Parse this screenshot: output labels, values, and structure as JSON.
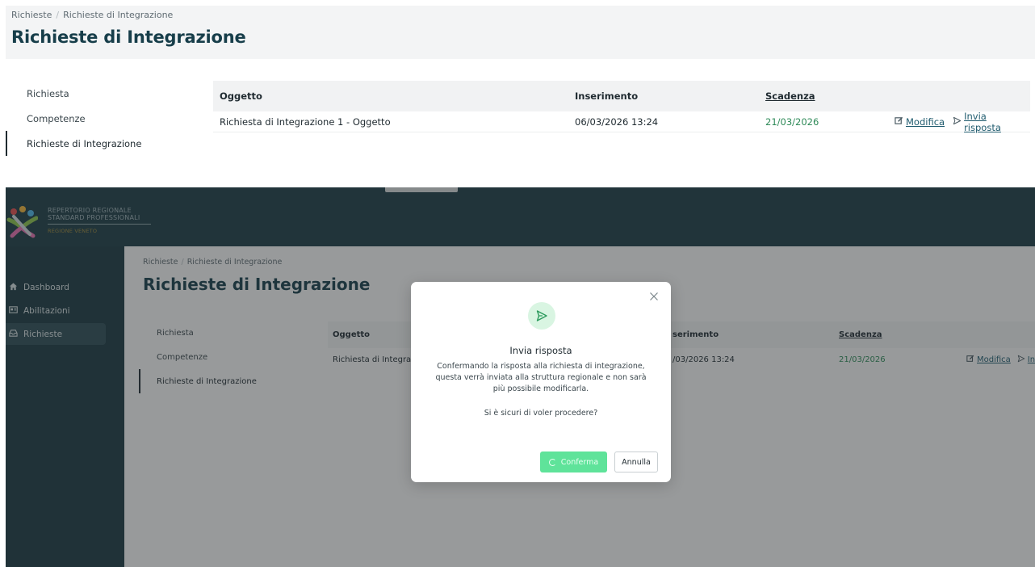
{
  "top": {
    "breadcrumb": [
      "Richieste",
      "Richieste di Integrazione"
    ],
    "breadcrumb_separator": "/",
    "title": "Richieste di Integrazione",
    "nav": [
      "Richiesta",
      "Competenze",
      "Richieste di Integrazione"
    ],
    "active_nav": "Richieste di Integrazione",
    "table": {
      "headers": [
        "Oggetto",
        "Inserimento",
        "Scadenza"
      ],
      "rows": [
        {
          "oggetto": "Richiesta di Integrazione 1 - Oggetto",
          "inserimento": "06/03/2026 13:24",
          "scadenza": "21/03/2026",
          "actions": [
            "Modifica",
            "Invia risposta"
          ]
        }
      ]
    }
  },
  "app": {
    "banner_button_color": "#d6dadb",
    "logo": {
      "line1": "REPERTORIO REGIONALE",
      "line2": "STANDARD PROFESSIONALI",
      "line3": "REGIONE VENETO"
    },
    "sidebar": [
      {
        "label": "Dashboard",
        "icon": "home-icon"
      },
      {
        "label": "Abilitazioni",
        "icon": "id-card-icon"
      },
      {
        "label": "Richieste",
        "icon": "inbox-icon",
        "active": true
      }
    ],
    "breadcrumb": [
      "Richieste",
      "Richieste di Integrazione"
    ],
    "breadcrumb_separator": "/",
    "title": "Richieste di Integrazione",
    "nav": [
      "Richiesta",
      "Competenze",
      "Richieste di Integrazione"
    ],
    "table": {
      "headers": [
        "Oggetto",
        "Inserimento",
        "Scadenza"
      ],
      "headers_visible": [
        "Oggetto",
        "serimento",
        "Scadenza"
      ],
      "row": {
        "oggetto": "Richiesta di Integraz",
        "inserimento": "/03/2026 13:24",
        "scadenza": "21/03/2026",
        "actions": [
          "Modifica",
          "Invia"
        ]
      }
    }
  },
  "modal": {
    "icon": "send-icon",
    "title": "Invia risposta",
    "body": "Confermando la risposta alla richiesta di integrazione, questa verrà inviata alla struttura regionale e non sarà più possibile modificarla.",
    "question": "Si è sicuri di voler procedere?",
    "confirm_label": "Conferma",
    "cancel_label": "Annulla",
    "close_icon": "close-icon"
  },
  "colors": {
    "brand_dark": "#1d3c45",
    "title": "#173e4a",
    "accent_green": "#5fe39a",
    "date_green": "#2e8a58",
    "modal_icon_bg": "#d9f5e2"
  }
}
